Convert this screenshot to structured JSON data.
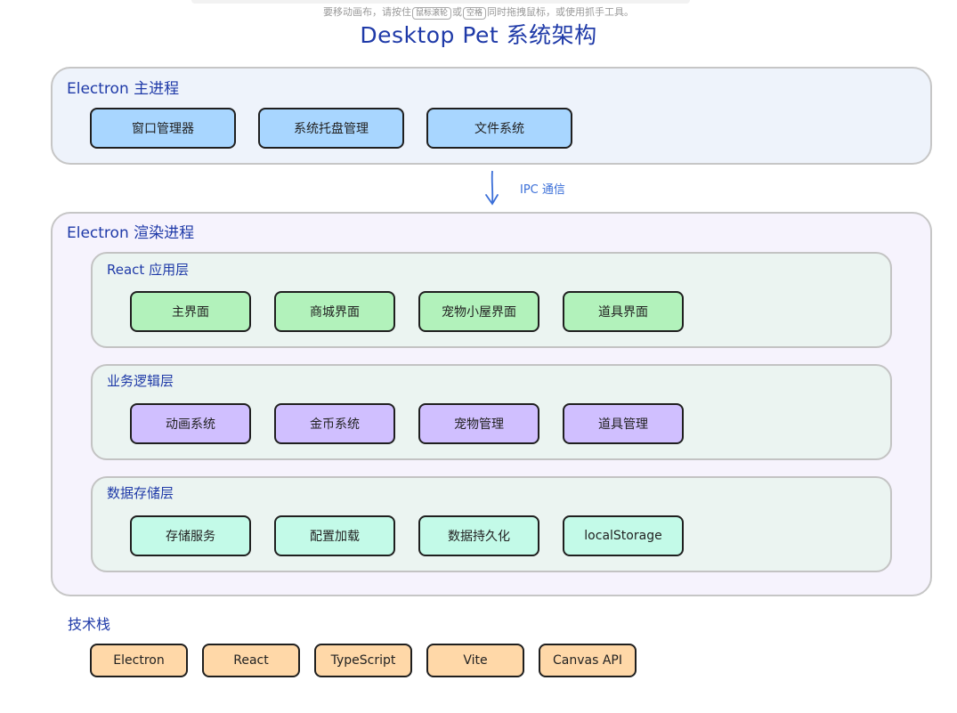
{
  "hint": {
    "text_before": "要移动画布，请按住",
    "key_wheel": "鼠标滚轮",
    "text_or": "或",
    "key_space": "空格",
    "text_after": "同时拖拽鼠标，或使用抓手工具。"
  },
  "title": "Desktop Pet 系统架构",
  "main_process": {
    "label": "Electron 主进程",
    "nodes": [
      "窗口管理器",
      "系统托盘管理",
      "文件系统"
    ]
  },
  "ipc": {
    "label": "IPC 通信"
  },
  "renderer": {
    "label": "Electron 渲染进程",
    "layers": [
      {
        "label": "React 应用层",
        "nodes": [
          "主界面",
          "商城界面",
          "宠物小屋界面",
          "道具界面"
        ]
      },
      {
        "label": "业务逻辑层",
        "nodes": [
          "动画系统",
          "金币系统",
          "宠物管理",
          "道具管理"
        ]
      },
      {
        "label": "数据存储层",
        "nodes": [
          "存储服务",
          "配置加载",
          "数据持久化",
          "localStorage"
        ]
      }
    ]
  },
  "tech_stack": {
    "label": "技术栈",
    "items": [
      "Electron",
      "React",
      "TypeScript",
      "Vite",
      "Canvas API"
    ]
  },
  "colors": {
    "main_process_fill": "#eef3fb",
    "renderer_fill": "#f6f3fd",
    "layer_fill": "#ebf4f1",
    "main_node": "#a8d6ff",
    "react_node": "#b2f2bb",
    "logic_node": "#d0bfff",
    "storage_node": "#c3fae8",
    "tech_node": "#ffd8a8",
    "arrow": "#3b6fd8"
  }
}
